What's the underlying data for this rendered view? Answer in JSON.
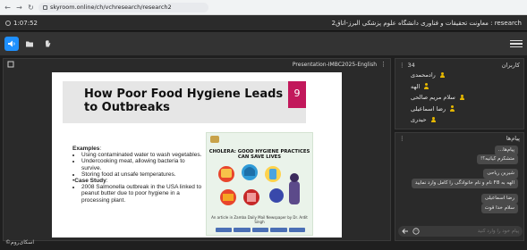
{
  "browser": {
    "back_icon": "←",
    "forward_icon": "→",
    "reload_icon": "↻",
    "url": "skyroom.online/ch/vchresearch/research2"
  },
  "header": {
    "timer": "1:07:52",
    "title": "research : معاونت تحقیقات و فناوری دانشگاه علوم پزشکی البرز-اتاق2"
  },
  "presentation": {
    "title": "Presentation-IMBC2025-English",
    "slide_number": "9",
    "slide_title": "How Poor Food Hygiene Leads to Outbreaks",
    "examples_heading": "Examples",
    "examples": [
      "Using contaminated water to wash vegetables.",
      "Undercooking meat, allowing bacteria to survive.",
      "Storing food at unsafe temperatures."
    ],
    "case_heading": "Case Study",
    "case_items": [
      "2008 Salmonella outbreak in the USA linked to peanut butter due to poor hygiene in a processing plant."
    ],
    "image_title": "CHOLERA: GOOD HYGIENE PRACTICES CAN SAVE LIVES",
    "image_caption": "An article in Zamba Daily Mail Newspaper by Dr. Ardit Singh"
  },
  "users": {
    "count": "34",
    "label": "کاربران",
    "items": [
      "رادمحمدی",
      "الهه",
      "سلام مریم صالحی",
      "رضا اسماعیلی",
      "حیدری"
    ]
  },
  "chat": {
    "label": "پیام‌ها",
    "messages": [
      {
        "text": "پیام‌ها..."
      },
      {
        "text": "متشکرم کیانیه؟!"
      },
      {
        "text": "شیرین ریاحی"
      },
      {
        "text": "الهه به F8 نام و نام خانوادگی را کامل وارد نمایید"
      },
      {
        "text": "رضا اسماعیلی"
      },
      {
        "text": "سلام خدا قوت"
      }
    ],
    "input_placeholder": "پیام خود را وارد کنید"
  },
  "footer": {
    "brand": "©اسکای‌روم"
  }
}
